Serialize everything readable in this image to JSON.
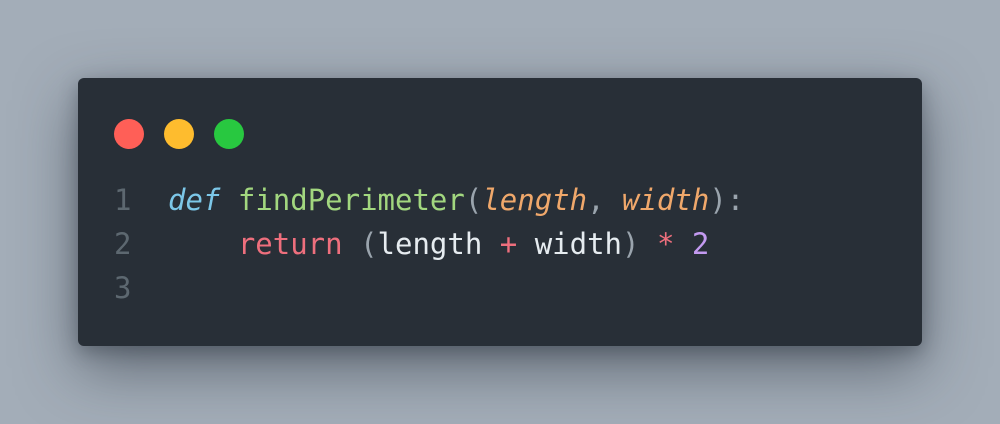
{
  "colors": {
    "background": "#a3adb8",
    "window": "#282f37",
    "close": "#ff5f57",
    "minimize": "#febc2e",
    "maximize": "#28c840",
    "line_number": "#5d6870",
    "keyword_def": "#7cc7e8",
    "function_name": "#a2d77f",
    "punctuation": "#9aa4ad",
    "param": "#f0a86b",
    "keyword_return": "#ee6f7d",
    "identifier": "#e6ecf0",
    "operator": "#ee6f7d",
    "number": "#c39af0"
  },
  "window_controls": [
    {
      "name": "close-button",
      "color": "#ff5f57"
    },
    {
      "name": "minimize-button",
      "color": "#febc2e"
    },
    {
      "name": "maximize-button",
      "color": "#28c840"
    }
  ],
  "code": {
    "lines": [
      {
        "number": "1",
        "tokens": [
          {
            "text": "def",
            "kind": "keyword_def",
            "italic": true
          },
          {
            "text": " ",
            "kind": "identifier"
          },
          {
            "text": "findPerimeter",
            "kind": "function_name"
          },
          {
            "text": "(",
            "kind": "punctuation"
          },
          {
            "text": "length",
            "kind": "param",
            "italic": true
          },
          {
            "text": ", ",
            "kind": "punctuation"
          },
          {
            "text": "width",
            "kind": "param",
            "italic": true
          },
          {
            "text": "):",
            "kind": "punctuation"
          }
        ]
      },
      {
        "number": "2",
        "tokens": [
          {
            "text": "    ",
            "kind": "identifier"
          },
          {
            "text": "return",
            "kind": "keyword_return"
          },
          {
            "text": " ",
            "kind": "identifier"
          },
          {
            "text": "(",
            "kind": "punctuation"
          },
          {
            "text": "length",
            "kind": "identifier"
          },
          {
            "text": " ",
            "kind": "identifier"
          },
          {
            "text": "+",
            "kind": "operator"
          },
          {
            "text": " ",
            "kind": "identifier"
          },
          {
            "text": "width",
            "kind": "identifier"
          },
          {
            "text": ")",
            "kind": "punctuation"
          },
          {
            "text": " ",
            "kind": "identifier"
          },
          {
            "text": "*",
            "kind": "operator"
          },
          {
            "text": " ",
            "kind": "identifier"
          },
          {
            "text": "2",
            "kind": "number"
          }
        ]
      },
      {
        "number": "3",
        "tokens": []
      }
    ]
  }
}
